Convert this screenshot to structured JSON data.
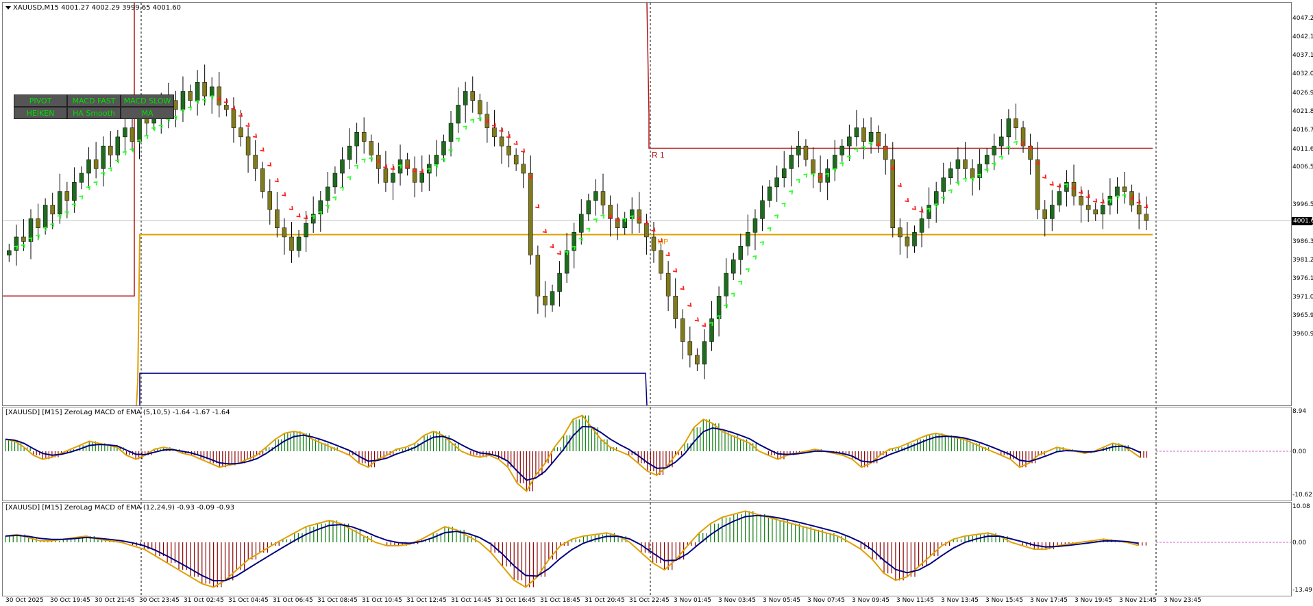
{
  "main": {
    "symbol_title": "XAUUSD,M15  4001.27 4002.29 3999.65 4001.60",
    "current_price": "4001.60",
    "r1_label": "R 1",
    "mp_label": "MP",
    "price_axis": [
      "4047.20",
      "4042.10",
      "4037.15",
      "4032.05",
      "4026.95",
      "4021.85",
      "4016.75",
      "4011.65",
      "4006.55",
      "3996.50",
      "3991.40",
      "3986.30",
      "3981.20",
      "3976.10",
      "3971.00",
      "3965.90",
      "3960.95"
    ],
    "buttons": [
      {
        "label": "PIVOT"
      },
      {
        "label": "MACD FAST"
      },
      {
        "label": "MACD SLOW"
      },
      {
        "label": "HEIKEN"
      },
      {
        "label": "HA Smooth"
      },
      {
        "label": "MA"
      }
    ],
    "colors": {
      "bull_candle": "#1f6b1f",
      "bear_candle": "#807a1c",
      "trend_up": "#2dff2d",
      "trend_down": "#ff2020",
      "r1_line": "#b01818",
      "mp_line": "#e0a000",
      "s1_line": "#000080"
    }
  },
  "macd_fast": {
    "title": "[XAUUSD] [M15] ZeroLag MACD of EMA (5,10,5) -1.64 -1.67 -1.64",
    "axis": [
      "8.94",
      "0.00",
      "-10.62"
    ]
  },
  "macd_slow": {
    "title": "[XAUUSD] [M15] ZeroLag MACD of EMA (12,24,9) -0.93 -0.09 -0.93",
    "axis": [
      "10.08",
      "0.00",
      "-13.49"
    ]
  },
  "time_axis": [
    "30 Oct 2025",
    "30 Oct 19:45",
    "30 Oct 21:45",
    "30 Oct 23:45",
    "31 Oct 02:45",
    "31 Oct 04:45",
    "31 Oct 06:45",
    "31 Oct 08:45",
    "31 Oct 10:45",
    "31 Oct 12:45",
    "31 Oct 14:45",
    "31 Oct 16:45",
    "31 Oct 18:45",
    "31 Oct 20:45",
    "31 Oct 22:45",
    "3 Nov 01:45",
    "3 Nov 03:45",
    "3 Nov 05:45",
    "3 Nov 07:45",
    "3 Nov 09:45",
    "3 Nov 11:45",
    "3 Nov 13:45",
    "3 Nov 15:45",
    "3 Nov 17:45",
    "3 Nov 19:45",
    "3 Nov 21:45",
    "3 Nov 23:45"
  ],
  "chart_data": {
    "type": "candlestick",
    "price_range": [
      3960.95,
      4049.5
    ],
    "closes": [
      3995,
      3998,
      3997,
      4002,
      4000,
      4005,
      4003,
      4008,
      4006,
      4010,
      4012,
      4015,
      4013,
      4018,
      4016,
      4020,
      4022,
      4019,
      4025,
      4023,
      4027,
      4024,
      4028,
      4026,
      4030,
      4028,
      4032,
      4029,
      4031,
      4027,
      4026,
      4022,
      4020,
      4016,
      4013,
      4008,
      4004,
      4000,
      3998,
      3995,
      3998,
      4001,
      4003,
      4006,
      4009,
      4012,
      4015,
      4018,
      4021,
      4019,
      4016,
      4013,
      4010,
      4012,
      4015,
      4013,
      4010,
      4012,
      4014,
      4016,
      4019,
      4023,
      4027,
      4030,
      4028,
      4025,
      4022,
      4020,
      4018,
      4016,
      4014,
      4012,
      3994,
      3985,
      3983,
      3986,
      3990,
      3995,
      3999,
      4003,
      4006,
      4008,
      4005,
      4002,
      4000,
      4002,
      4004,
      4001,
      3998,
      3995,
      3990,
      3985,
      3980,
      3975,
      3972,
      3970,
      3975,
      3980,
      3985,
      3990,
      3993,
      3996,
      3999,
      4002,
      4006,
      4009,
      4011,
      4013,
      4016,
      4018,
      4015,
      4012,
      4010,
      4013,
      4016,
      4018,
      4020,
      4022,
      4019,
      4021,
      4018,
      4015,
      4000,
      3998,
      3996,
      3999,
      4002,
      4005,
      4008,
      4011,
      4013,
      4015,
      4013,
      4011,
      4014,
      4016,
      4018,
      4020,
      4024,
      4022,
      4018,
      4015,
      4004,
      4002,
      4005,
      4008,
      4010,
      4007,
      4005,
      4004,
      4003,
      4005,
      4007,
      4009,
      4008,
      4005,
      4003,
      4001.6
    ],
    "macd_fast_hist": [
      3,
      2.5,
      1,
      -1,
      -2,
      -1.5,
      -0.5,
      0.5,
      1.5,
      2.5,
      2,
      1.5,
      1,
      -1,
      -2,
      -1,
      0.5,
      1,
      0.5,
      -0.5,
      -1,
      -2,
      -3,
      -4,
      -3.5,
      -3,
      -2,
      -1,
      1,
      3,
      4.5,
      5,
      4.5,
      3,
      2,
      1,
      0,
      -1,
      -3,
      -4,
      -2,
      -1,
      0.5,
      1,
      2,
      4,
      5,
      4,
      2,
      0,
      -1,
      -1.5,
      -1,
      -2,
      -4,
      -8,
      -10,
      -6,
      -3,
      1,
      4,
      8,
      9,
      6,
      3,
      1,
      0,
      -1,
      -3,
      -5,
      -6,
      -4,
      -1,
      2,
      6,
      8,
      7,
      5,
      4,
      3,
      2,
      0,
      -1,
      -2,
      -1,
      -0.5,
      0,
      0.5,
      0,
      -0.5,
      -1,
      -2,
      -4,
      -3,
      -1,
      0.5,
      1,
      2,
      3,
      4,
      4.5,
      4,
      3.5,
      3,
      2,
      1,
      0,
      -1,
      -2,
      -4,
      -3,
      -1,
      0,
      1,
      0.5,
      0,
      -0.5,
      0,
      1,
      2,
      1.5,
      0,
      -1.64
    ],
    "macd_slow_hist": [
      2,
      2.5,
      1.5,
      0.5,
      0.5,
      1,
      1.5,
      2,
      1,
      0.5,
      0,
      -1,
      -2,
      -4,
      -6,
      -8,
      -10,
      -12,
      -13,
      -11,
      -8,
      -5,
      -3,
      -1,
      1,
      3,
      5,
      6,
      7,
      6,
      4,
      2,
      0,
      -1,
      -1,
      -0.5,
      1,
      3,
      5,
      4,
      2,
      0,
      -3,
      -7,
      -11,
      -13,
      -10,
      -5,
      -1,
      1,
      2,
      2.5,
      3,
      2,
      0,
      -3,
      -6,
      -8,
      -5,
      -1,
      3,
      6,
      8,
      9,
      10,
      9,
      8,
      7,
      6,
      5,
      4,
      3,
      2,
      0,
      -2,
      -5,
      -9,
      -11,
      -10,
      -7,
      -4,
      -1,
      1,
      2,
      2.5,
      3,
      2,
      0,
      -1,
      -2,
      -2,
      -1,
      -0.5,
      0,
      0.5,
      1,
      0.5,
      0,
      -0.93
    ]
  }
}
